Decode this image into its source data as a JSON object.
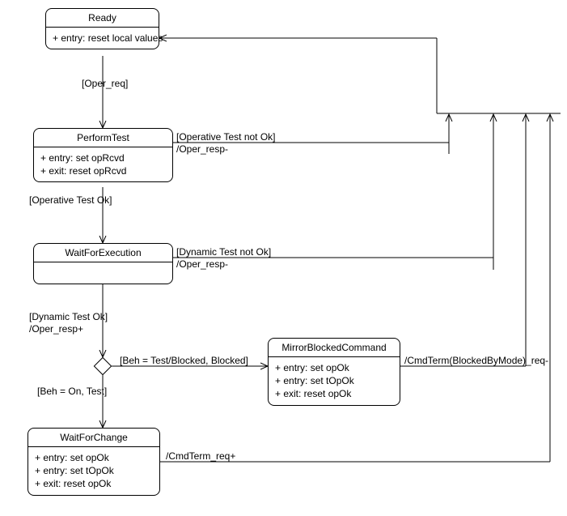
{
  "states": {
    "ready": {
      "title": "Ready",
      "lines": [
        "+ entry: reset local values"
      ]
    },
    "performTest": {
      "title": "PerformTest",
      "lines": [
        "+ entry: set opRcvd",
        "+ exit: reset opRcvd"
      ]
    },
    "waitForExecution": {
      "title": "WaitForExecution",
      "lines": []
    },
    "mirrorBlocked": {
      "title": "MirrorBlockedCommand",
      "lines": [
        "+ entry: set opOk",
        "+ entry: set tOpOk",
        "+ exit: reset opOk"
      ]
    },
    "waitForChange": {
      "title": "WaitForChange",
      "lines": [
        "+ entry: set opOk",
        "+ entry: set tOpOk",
        "+ exit: reset opOk"
      ]
    }
  },
  "edges": {
    "ready_to_perform": {
      "guard": "[Oper_req]"
    },
    "perform_to_ready": {
      "guard": "[Operative Test not Ok]",
      "action": "/Oper_resp-"
    },
    "perform_to_wait": {
      "guard": "[Operative Test Ok]"
    },
    "waitexec_to_ready": {
      "guard": "[Dynamic Test not Ok]",
      "action": "/Oper_resp-"
    },
    "waitexec_down": {
      "guard": "[Dynamic Test Ok]",
      "action": "/Oper_resp+"
    },
    "dec_to_mirror": {
      "guard": "[Beh = Test/Blocked, Blocked]"
    },
    "dec_to_waitchange": {
      "guard": "[Beh = On, Test]"
    },
    "mirror_to_ready": {
      "action": "/CmdTerm(BlockedByMode)_req-"
    },
    "waitchange_to_ready": {
      "action": "/CmdTerm_req+"
    }
  },
  "chart_data": {
    "type": "state_machine",
    "states": [
      "Ready",
      "PerformTest",
      "WaitForExecution",
      "MirrorBlockedCommand",
      "WaitForChange"
    ],
    "transitions": [
      {
        "from": "Ready",
        "to": "PerformTest",
        "guard": "Oper_req"
      },
      {
        "from": "PerformTest",
        "to": "Ready",
        "guard": "Operative Test not Ok",
        "action": "Oper_resp-"
      },
      {
        "from": "PerformTest",
        "to": "WaitForExecution",
        "guard": "Operative Test Ok"
      },
      {
        "from": "WaitForExecution",
        "to": "Ready",
        "guard": "Dynamic Test not Ok",
        "action": "Oper_resp-"
      },
      {
        "from": "WaitForExecution",
        "to": "decision",
        "guard": "Dynamic Test Ok",
        "action": "Oper_resp+"
      },
      {
        "from": "decision",
        "to": "MirrorBlockedCommand",
        "guard": "Beh = Test/Blocked, Blocked"
      },
      {
        "from": "decision",
        "to": "WaitForChange",
        "guard": "Beh = On, Test"
      },
      {
        "from": "MirrorBlockedCommand",
        "to": "Ready",
        "action": "CmdTerm(BlockedByMode)_req-"
      },
      {
        "from": "WaitForChange",
        "to": "Ready",
        "action": "CmdTerm_req+"
      }
    ]
  }
}
